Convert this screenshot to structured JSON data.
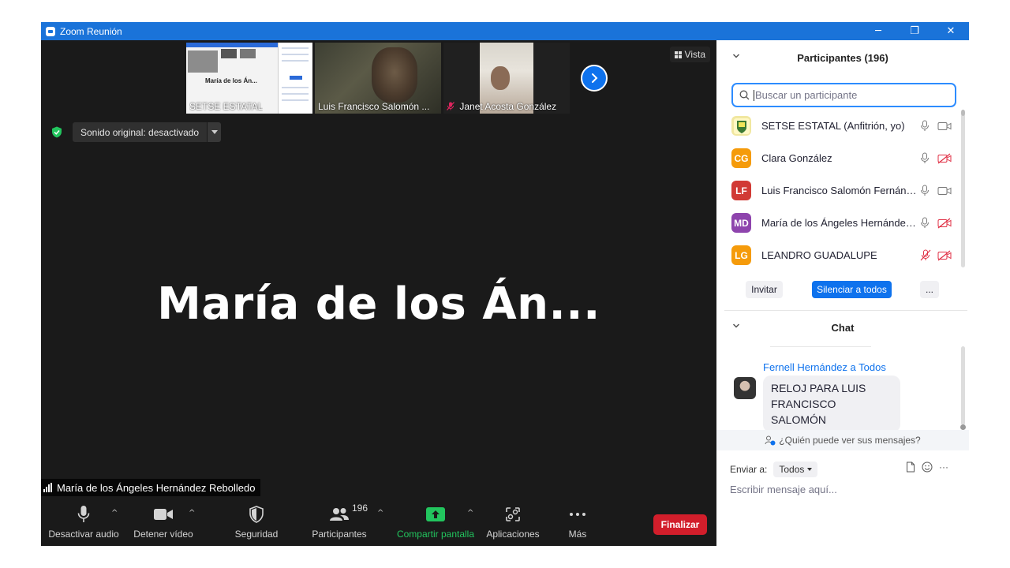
{
  "window": {
    "title": "Zoom Reunión",
    "min_label": "─",
    "restore_label": "❐",
    "close_label": "✕"
  },
  "stage": {
    "vista_label": "Vista",
    "thumbnails": [
      {
        "label": "SETSE ESTATAL",
        "inner_text": "María de los Án..."
      },
      {
        "label": "Luis Francisco Salomón ..."
      },
      {
        "label": "Janet Acosta González"
      }
    ],
    "sound_original": "Sonido original: desactivado",
    "active_speaker_display": "María de los Án...",
    "active_speaker_full": "María de los Ángeles Hernández Rebolledo"
  },
  "toolbar": {
    "mute_label": "Desactivar audio",
    "video_label": "Detener vídeo",
    "security_label": "Seguridad",
    "participants_label": "Participantes",
    "participants_count": "196",
    "share_label": "Compartir pantalla",
    "apps_label": "Aplicaciones",
    "more_label": "Más",
    "end_label": "Finalizar"
  },
  "participants_panel": {
    "title": "Participantes (196)",
    "search_placeholder": "Buscar un participante",
    "participants": [
      {
        "initials": "",
        "name": "SETSE ESTATAL (Anfitrión, yo)",
        "color": "#f1e7a0",
        "mic": "on",
        "video": "on"
      },
      {
        "initials": "CG",
        "name": "Clara González",
        "color": "#f59b0b",
        "mic": "on",
        "video": "off"
      },
      {
        "initials": "LF",
        "name": "Luis Francisco Salomón Fernández",
        "color": "#d13a35",
        "mic": "on",
        "video": "on"
      },
      {
        "initials": "MD",
        "name": "María de los Ángeles Hernández Rebolledo",
        "color": "#8e44ad",
        "mic": "on",
        "video": "off"
      },
      {
        "initials": "LG",
        "name": " LEANDRO GUADALUPE",
        "color": "#f59b0b",
        "mic": "off",
        "video": "off"
      }
    ],
    "invite_label": "Invitar",
    "mute_all_label": "Silenciar a todos",
    "more_label": "..."
  },
  "chat_panel": {
    "title": "Chat",
    "messages": [
      {
        "sender": "Fernell Hernández a Todos",
        "text": "RELOJ PARA LUIS FRANCISCO SALOMÓN"
      }
    ],
    "who_can_see": "¿Quién puede ver sus mensajes?",
    "send_to_label": "Enviar a:",
    "send_to_value": "Todos",
    "input_placeholder": "Escribir mensaje aquí...",
    "more_label": "···"
  },
  "colors": {
    "accent": "#0e72ed",
    "titlebar": "#1a73d9",
    "end": "#d21e2b",
    "share": "#22c55e",
    "stage": "#1a1a1a"
  }
}
